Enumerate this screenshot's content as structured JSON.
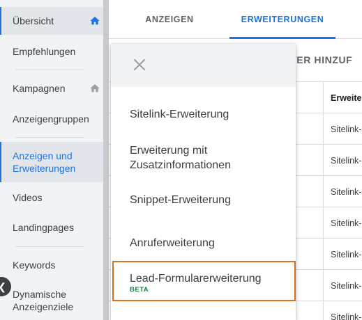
{
  "sidebar": {
    "items": [
      {
        "label": "Übersicht"
      },
      {
        "label": "Empfehlungen"
      },
      {
        "label": "Kampagnen"
      },
      {
        "label": "Anzeigengruppen"
      },
      {
        "label": "Anzeigen und Erweiterungen"
      },
      {
        "label": "Videos"
      },
      {
        "label": "Landingpages"
      },
      {
        "label": "Keywords"
      },
      {
        "label": "Dynamische Anzeigenziele"
      }
    ]
  },
  "tabs": [
    {
      "label": "ANZEIGEN"
    },
    {
      "label": "ERWEITERUNGEN"
    }
  ],
  "filter_label": "LTER HINZUF",
  "table": {
    "header": "Erweite",
    "rows": [
      "Sitelink-",
      "Sitelink-",
      "Sitelink-",
      "Sitelink-",
      "Sitelink-",
      "Sitelink-",
      "Sitelink-"
    ]
  },
  "menu": {
    "items": [
      {
        "label": "Sitelink-Erweiterung"
      },
      {
        "label": "Erweiterung mit Zusatzinformationen"
      },
      {
        "label": "Snippet-Erweiterung"
      },
      {
        "label": "Anruferweiterung"
      },
      {
        "label": "Lead-Formularerweiterung",
        "badge": "BETA"
      }
    ]
  },
  "colors": {
    "accent": "#1a73e8",
    "highlight_border": "#d5711e",
    "beta": "#188038",
    "sidebar_bg": "#f1f3f4"
  }
}
